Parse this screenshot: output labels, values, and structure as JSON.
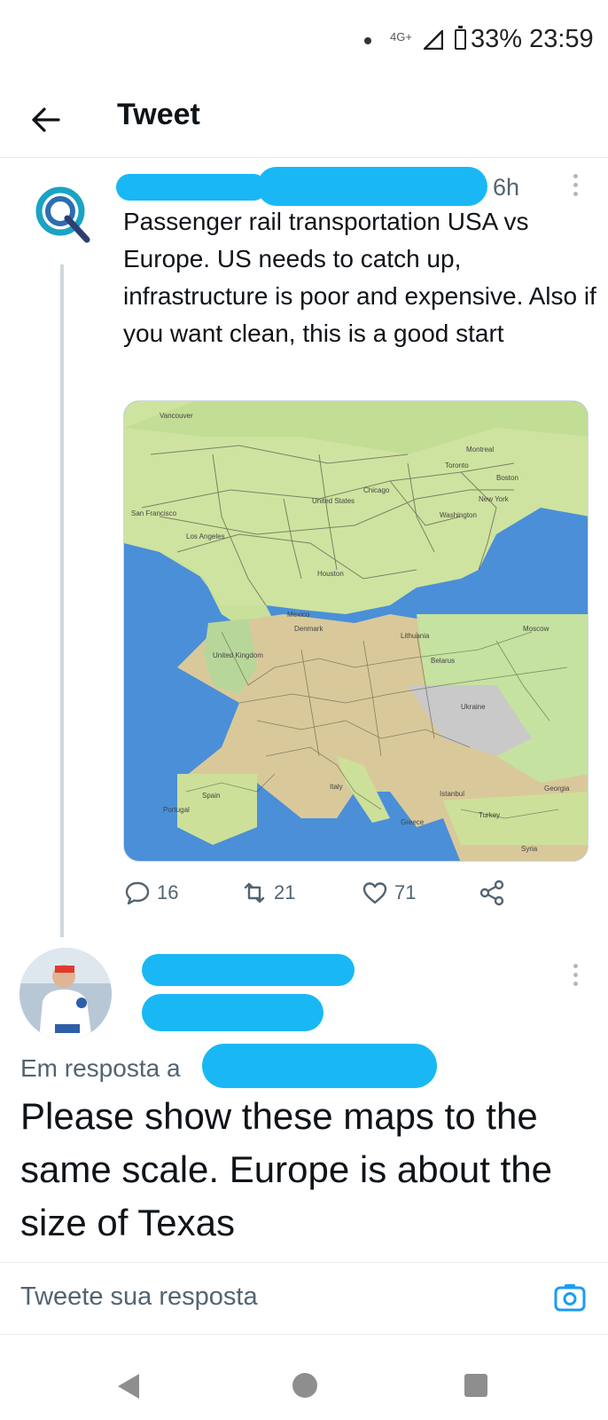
{
  "status_bar": {
    "network": "4G+",
    "battery_and_time": "33% 23:59"
  },
  "header": {
    "title": "Tweet"
  },
  "tweet": {
    "time": "6h",
    "text": "Passenger rail transportation USA vs Europe. US needs to catch up, infrastructure is poor and expensive. Also if you want clean, this is a good start",
    "map_labels": [
      "Vancouver",
      "Montreal",
      "Toronto",
      "Boston",
      "New York",
      "Chicago",
      "United States",
      "Washington",
      "San Francisco",
      "Los Angeles",
      "Houston",
      "Mexico",
      "Denmark",
      "Moscow",
      "Lithuania",
      "Belarus",
      "United Kingdom",
      "Ukraine",
      "Spain",
      "Italy",
      "Portugal",
      "Istanbul",
      "Greece",
      "Turkey",
      "Georgia",
      "Syria"
    ],
    "actions": {
      "replies": "16",
      "retweets": "21",
      "likes": "71"
    }
  },
  "reply": {
    "in_reply_to": "Em resposta a",
    "text": "Please show these maps to the same scale. Europe is about the size of Texas"
  },
  "composer": {
    "placeholder": "Tweete sua resposta"
  },
  "colors": {
    "redaction": "#19b8f5",
    "accent": "#1d9bf0",
    "text": "#0f1419",
    "muted": "#536471"
  }
}
